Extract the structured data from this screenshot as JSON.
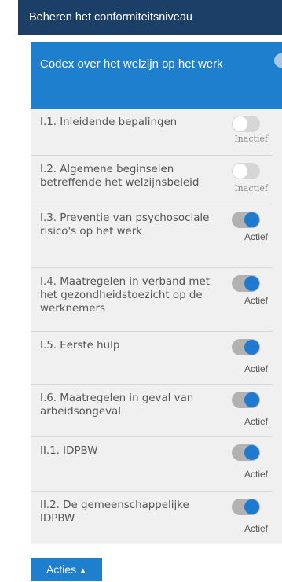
{
  "topbar": {
    "title": "Beheren het conformiteitsniveau"
  },
  "panel": {
    "title": "Codex over het welzijn op het werk",
    "items": [
      {
        "label": "I.1. Inleidende bepalingen",
        "active": false,
        "status": "Inactief"
      },
      {
        "label": "I.2. Algemene beginselen betreffende het welzijnsbeleid",
        "active": false,
        "status": "Inactief"
      },
      {
        "label": "I.3. Preventie van psychosociale risico's op het werk",
        "active": true,
        "status": "Actief"
      },
      {
        "label": "I.4. Maatregelen in verband met het gezondheidstoezicht op de werknemers",
        "active": true,
        "status": "Actief"
      },
      {
        "label": "I.5. Eerste hulp",
        "active": true,
        "status": "Actief"
      },
      {
        "label": "I.6. Maatregelen in geval van arbeidsongeval",
        "active": true,
        "status": "Actief"
      },
      {
        "label": "II.1. IDPBW",
        "active": true,
        "status": "Actief"
      },
      {
        "label": "II.2. De gemeenschappelijke IDPBW",
        "active": true,
        "status": "Actief"
      }
    ]
  },
  "actions": {
    "label": "Acties",
    "caret": "▲"
  },
  "colors": {
    "topbar": "#1b3f66",
    "accent": "#1f7fcf",
    "toggle_on": "#1e7ad0",
    "toggle_off": "#d6d6d6"
  }
}
